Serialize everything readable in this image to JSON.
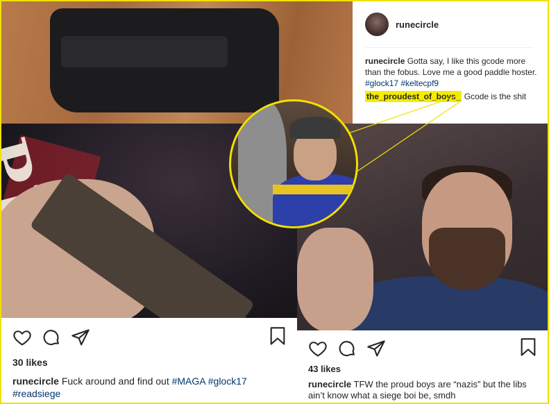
{
  "comment_panel": {
    "username": "runecircle",
    "caption_user": "runecircle",
    "caption_text": " Gotta say, I like this gcode more than the fobus. Love me a good paddle hoster. ",
    "hashtags": "#glock17 #keltecpf9",
    "reply_user": "the_proudest_of_boys_",
    "reply_text": " Gcode is the shit"
  },
  "post_left": {
    "likes": "30 likes",
    "caption_user": "runecircle",
    "caption_text": " Fuck around and find out ",
    "hashtags": "#MAGA #glock17 #readsiege",
    "shirt_text": "PENCE"
  },
  "post_right": {
    "likes": "43 likes",
    "caption_user": "runecircle",
    "caption_text": " TFW the proud boys are “nazis” but the libs ain’t know what a siege boi be, smdh"
  },
  "icons": {
    "like": "heart-icon",
    "comment": "comment-icon",
    "share": "share-icon",
    "save": "bookmark-icon"
  },
  "colors": {
    "highlight": "#f5ec00",
    "frame": "#f2e000",
    "hashtag": "#003569"
  }
}
